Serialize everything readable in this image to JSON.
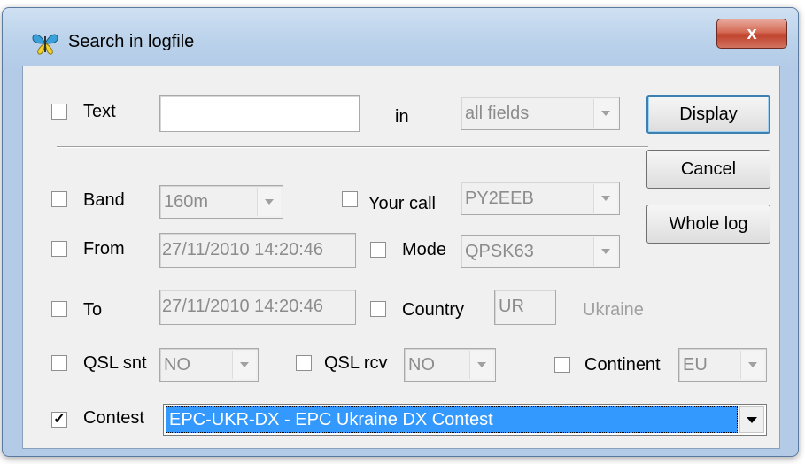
{
  "window": {
    "title": "Search in logfile",
    "close_glyph": "x",
    "icon": "butterfly-icon"
  },
  "text_row": {
    "label": "Text",
    "checked": false,
    "value": "",
    "in_label": "in",
    "fields_value": "all fields"
  },
  "band": {
    "label": "Band",
    "checked": false,
    "value": "160m"
  },
  "your_call": {
    "label": "Your call",
    "checked": false,
    "value": "PY2EEB"
  },
  "from": {
    "label": "From",
    "checked": false,
    "value": "27/11/2010 14:20:46"
  },
  "mode": {
    "label": "Mode",
    "checked": false,
    "value": "QPSK63"
  },
  "to": {
    "label": "To",
    "checked": false,
    "value": "27/11/2010 14:20:46"
  },
  "country": {
    "label": "Country",
    "checked": false,
    "value": "UR",
    "name": "Ukraine"
  },
  "qsl_snt": {
    "label": "QSL snt",
    "checked": false,
    "value": "NO"
  },
  "qsl_rcv": {
    "label": "QSL rcv",
    "checked": false,
    "value": "NO"
  },
  "continent": {
    "label": "Continent",
    "checked": false,
    "value": "EU"
  },
  "contest": {
    "label": "Contest",
    "checked": true,
    "value": "EPC-UKR-DX - EPC Ukraine DX Contest"
  },
  "buttons": {
    "display": "Display",
    "cancel": "Cancel",
    "whole_log": "Whole log"
  },
  "glyphs": {
    "check": "✓"
  },
  "colors": {
    "selection": "#3399ff",
    "close": "#c7472f",
    "frame": "#b9d1ea"
  }
}
